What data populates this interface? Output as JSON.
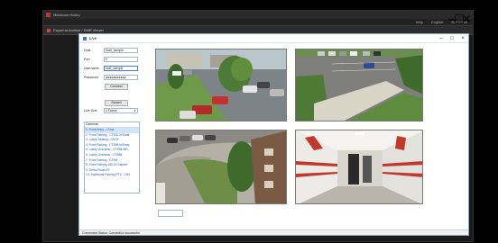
{
  "app": {
    "title": "Milestone Husky",
    "menu_right": [
      "Help",
      "English",
      "Subscribe"
    ]
  },
  "subwindow": {
    "title": "Export to Archive / DMR Viewer"
  },
  "dialog": {
    "title": "Live",
    "host_label": "Host",
    "host_value": "fluxit_sample",
    "port_label": "Port",
    "port_value": "0",
    "username_label": "Username",
    "username_value": "user_sample",
    "password_label": "Password",
    "password_value": "●●●●●●●●●●●",
    "connect_label": "Connect",
    "search_label": "Search",
    "layout_label": "Live Grid",
    "layout_value": "4 Frame",
    "cameras_header": "Cameras",
    "cameras": [
      "1. Front Entry - L7ma",
      "2. Front Parking - CT920 in/Smar",
      "3. Lobby Seating - CM-H",
      "4. Front Parking - CT998 in/Smar",
      "5. Lobby Overview - CT998-WR",
      "6. Lobby Overview - CT888",
      "7. Front Parking - CT9M",
      "8. Front Parking 180-20 Stepert",
      "9. Demo Room-Pt",
      "10. Southeast Parking PTZ - CB3"
    ],
    "status_text": "Connection Status: Connection successful"
  },
  "colors": {
    "link": "#1e5bb8",
    "selection": "#cfe3fb",
    "hallway_stripe": "#c0392b"
  }
}
